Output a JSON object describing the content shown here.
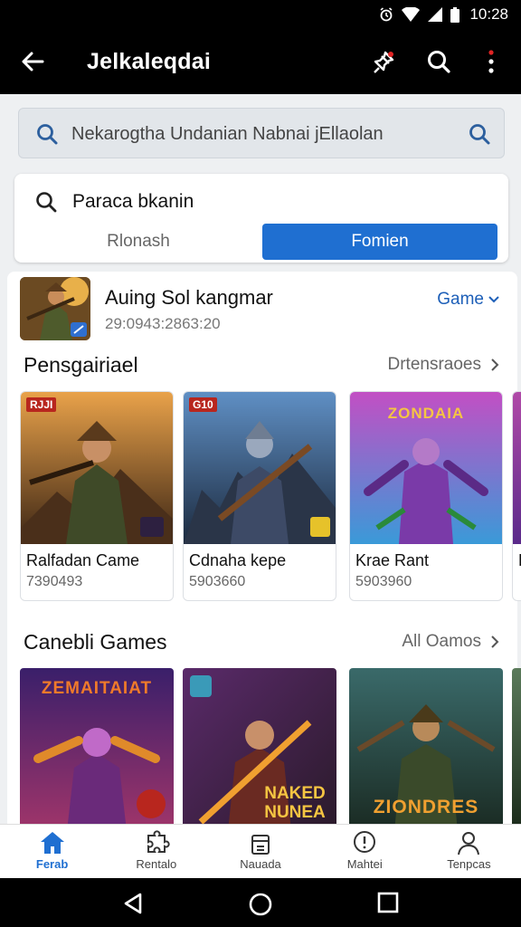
{
  "status_bar": {
    "time": "10:28",
    "icons": [
      "alarm-icon",
      "wifi-icon",
      "signal-icon",
      "battery-icon"
    ]
  },
  "app_bar": {
    "title": "Jelkaleqdai",
    "actions": [
      "back-arrow-icon",
      "pin-icon",
      "search-icon",
      "more-vert-icon"
    ],
    "more_dot_color": "#e02424"
  },
  "search": {
    "placeholder": "Nekarogtha Undanian Nabnai jEllaolan"
  },
  "filter": {
    "text": "Paraca bkanin",
    "options": [
      {
        "label": "Rlonash",
        "selected": false
      },
      {
        "label": "Fomien",
        "selected": true
      }
    ],
    "accent": "#1f6fd1"
  },
  "game_header": {
    "name": "Auing Sol kangmar",
    "stat": "29:0943:2863:20",
    "chip": "Game"
  },
  "sections": [
    {
      "title": "Pensgairiael",
      "link": "Drtensraoes",
      "items": [
        {
          "name": "Ralfadan Came",
          "count": "7390493",
          "badge": "RJJI"
        },
        {
          "name": "Cdnaha kepe",
          "count": "5903660",
          "badge": "G10"
        },
        {
          "name": "Krae Rant",
          "count": "5903960",
          "art_title": "ZONDAIA"
        },
        {
          "name": "K"
        }
      ]
    },
    {
      "title": "Canebli Games",
      "link": "All Oamos",
      "items": [
        {
          "art_title": "ZEMAITAIAT"
        },
        {
          "art_title": "NAKED NUNEA"
        },
        {
          "art_title": "ZIONDRES"
        }
      ]
    }
  ],
  "bottom_nav": [
    {
      "label": "Ferab",
      "icon": "home-icon",
      "active": true
    },
    {
      "label": "Rentalo",
      "icon": "puzzle-icon",
      "active": false
    },
    {
      "label": "Nauada",
      "icon": "store-icon",
      "active": false
    },
    {
      "label": "Mahtei",
      "icon": "shield-alert-icon",
      "active": false
    },
    {
      "label": "Tenpcas",
      "icon": "profile-icon",
      "active": false
    }
  ],
  "system_nav": [
    "back-triangle-icon",
    "home-circle-icon",
    "recents-square-icon"
  ]
}
